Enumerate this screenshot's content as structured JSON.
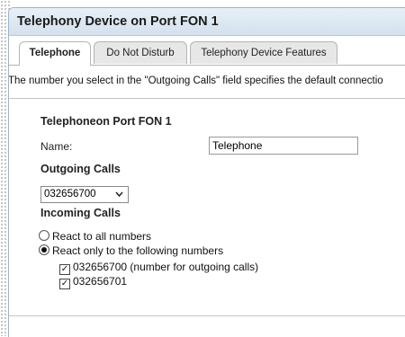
{
  "window": {
    "title": "Telephony Device on Port FON 1"
  },
  "tabs": [
    {
      "label": "Telephone",
      "active": true
    },
    {
      "label": "Do Not Disturb",
      "active": false
    },
    {
      "label": "Telephony Device Features",
      "active": false
    }
  ],
  "info_text": "The number you select in the \"Outgoing Calls\" field specifies the default connectio",
  "section": {
    "heading": "Telephoneon Port FON 1",
    "name_label": "Name:",
    "name_value": "Telephone",
    "outgoing_heading": "Outgoing Calls",
    "outgoing_selected": "032656700",
    "incoming_heading": "Incoming Calls",
    "radio_all": {
      "label": "React to all numbers",
      "checked": false
    },
    "radio_following": {
      "label": "React only to the following numbers",
      "checked": true
    },
    "numbers": [
      {
        "label": "032656700  (number for outgoing calls)",
        "checked": true
      },
      {
        "label": "032656701",
        "checked": true
      }
    ]
  },
  "icons": {
    "dropdown": "chevron-down-icon",
    "checkbox_mark": "✓"
  }
}
